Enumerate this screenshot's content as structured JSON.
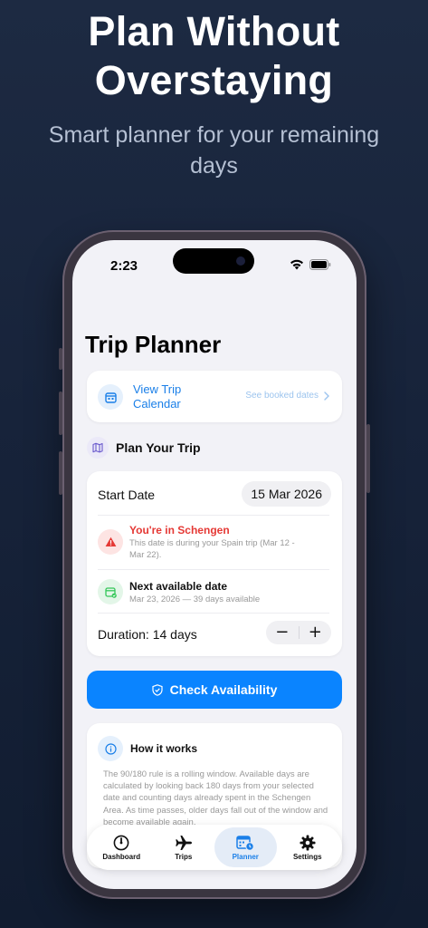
{
  "hero": {
    "title_line1": "Plan Without",
    "title_line2": "Overstaying",
    "subtitle": "Smart planner for your remaining days"
  },
  "status_bar": {
    "time": "2:23"
  },
  "page": {
    "title": "Trip Planner"
  },
  "calendar_card": {
    "link_label": "View Trip Calendar",
    "hint": "See booked dates"
  },
  "plan_section": {
    "title": "Plan Your Trip"
  },
  "plan_card": {
    "start_label": "Start Date",
    "start_value": "15 Mar 2026",
    "warning_title": "You're in Schengen",
    "warning_text": "This date is during your Spain trip (Mar 12 - Mar 22).",
    "next_title": "Next available date",
    "next_text": "Mar 23, 2026 — 39 days available",
    "duration_label": "Duration: 14 days",
    "minus": "−",
    "plus": "+"
  },
  "check_button": {
    "label": "Check Availability"
  },
  "how_it_works": {
    "title": "How it works",
    "text": "The 90/180 rule is a rolling window. Available days are calculated by looking back 180 days from your selected date and counting days already spent in the Schengen Area. As time passes, older days fall out of the window and become available again."
  },
  "tabbar": {
    "dashboard": "Dashboard",
    "trips": "Trips",
    "planner": "Planner",
    "settings": "Settings"
  },
  "colors": {
    "accent": "#0a84ff",
    "link": "#1a7fe8",
    "warning": "#e53935",
    "success": "#34c759",
    "background": "#1d2a42"
  }
}
